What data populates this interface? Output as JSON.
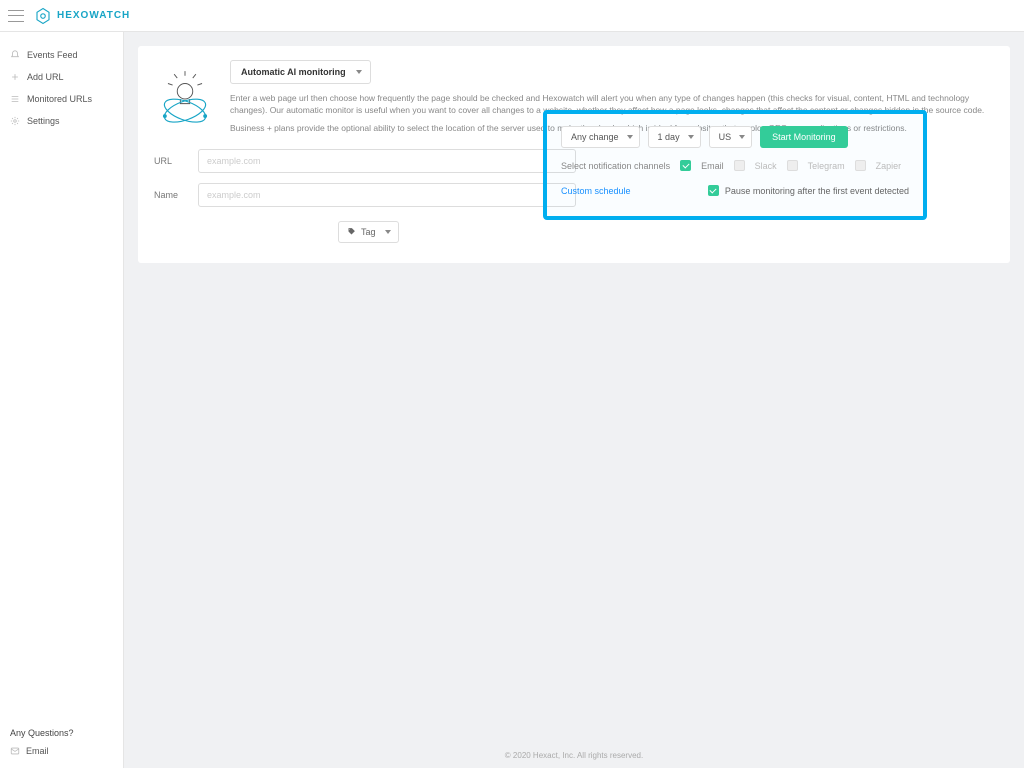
{
  "brand": "HEXOWATCH",
  "sidebar": {
    "items": [
      {
        "label": "Events Feed"
      },
      {
        "label": "Add URL"
      },
      {
        "label": "Monitored URLs"
      },
      {
        "label": "Settings"
      }
    ],
    "questions": "Any Questions?",
    "email": "Email"
  },
  "page": {
    "monitor_type": "Automatic AI monitoring",
    "desc1": "Enter a web page url then choose how frequently the page should be checked and Hexowatch will alert you when any type of changes happen (this checks for visual, content, HTML and technology changes). Our automatic monitor is useful when you want to cover all changes to a website, whether they affect how a page looks, changes that affect the content or changes hidden in the source code.",
    "desc2": "Business + plans provide the optional ability to select the location of the server used to make the check, which is ideal for websites that employ GEO personalisations or restrictions.",
    "url_label": "URL",
    "url_placeholder": "example.com",
    "name_label": "Name",
    "name_placeholder": "example.com",
    "tag_label": "Tag"
  },
  "controls": {
    "change": "Any change",
    "freq": "1 day",
    "region": "US",
    "start": "Start Monitoring",
    "notif_label": "Select notification channels",
    "ch_email": "Email",
    "ch_slack": "Slack",
    "ch_telegram": "Telegram",
    "ch_zapier": "Zapier",
    "custom": "Custom schedule",
    "pause": "Pause monitoring after the first event detected"
  },
  "footer": "© 2020 Hexact, Inc. All rights reserved."
}
